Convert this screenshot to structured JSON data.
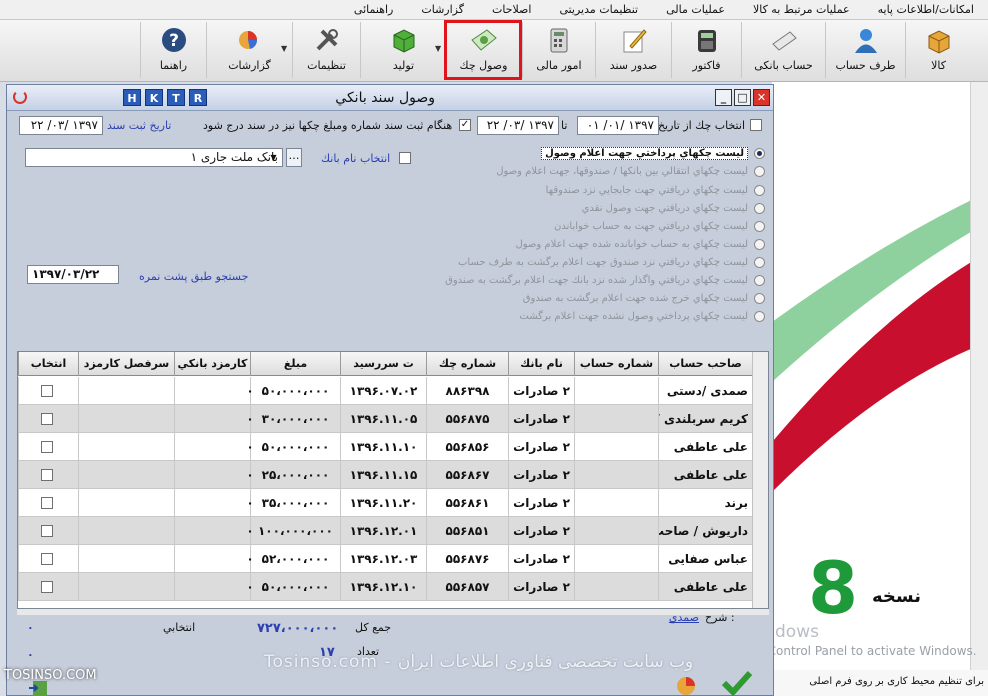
{
  "menu": [
    "امکانات/اطلاعات پایه",
    "عملیات مرتبط به کالا",
    "عملیات مالی",
    "تنظیمات مدیریتی",
    "اصلاحات",
    "گزارشات",
    "راهنمائی"
  ],
  "toolbar": {
    "kala": "کالا",
    "taraf_hesab": "طرف حساب",
    "hesab_banki": "حساب بانکی",
    "factor": "فاکتور",
    "sodoor_sanad": "صدور سند",
    "omoor_mali": "امور مالی",
    "vosool_cheque": "وصول چك",
    "tolid": "تولید",
    "tanzimat": "تنظیمات",
    "gozareshat": "گزارشات",
    "rahnama": "راهنما"
  },
  "dialog": {
    "title": "وصول سند بانكي",
    "hotkeys": [
      "H",
      "K",
      "T",
      "R"
    ],
    "filter_date_label": "انتخاب چك از تاريخ",
    "date_from": "۱۳۹۷ /۰۱/ ۰۱",
    "to_label": "تا",
    "date_to": "۱۳۹۷ /۰۳/ ۲۲",
    "insert_amount_label": "هنگام ثبت سند شماره ومبلغ چکها نیز در سند درج شود",
    "reg_date_label": "تاريخ ثبت سند",
    "reg_date": "۱۳۹۷ /۰۳/ ۲۲",
    "bank_select_label": "انتخاب نام بانك",
    "bank_name": "بانک ملت جاری ۱",
    "search_label": "جستجو طبق پشت نمره",
    "search_date": "۱۳۹۷/۰۳/۲۲",
    "radio_options": [
      "ليست چکهاي پرداختي جهت اعلام وصول",
      "ليست چکهاي انتقالي بين بانكها / صندوقها، جهت اعلام وصول",
      "ليست چکهاي دريافتي جهت جابجايي نزد صندوقها",
      "ليست چکهاي دريافتي جهت وصول نقدي",
      "ليست چکهاي دريافتي جهت به حساب خواباندن",
      "ليست چکهاي به حساب خوابانده شده جهت اعلام وصول",
      "ليست چکهاي دريافتي نزد صندوق جهت اعلام برگشت به طرف حساب",
      "ليست چکهاي دريافتي واگذار شده نزد بانك جهت اعلام برگشت به صندوق",
      "ليست چکهاي خرج شده جهت اعلام برگشت به صندوق",
      "ليست چکهاي پرداختي وصول نشده جهت اعلام برگشت"
    ],
    "columns": [
      "صاحب حساب",
      "شماره حساب",
      "نام بانك",
      "شماره چك",
      "ت سررسيد",
      "مبلغ",
      "كارمزد بانكي",
      "سرفصل كارمزد",
      "انتخاب"
    ],
    "rows": [
      {
        "owner": "صمدی /دستی",
        "bank": "۲ صادرات",
        "cheque": "۸۸۶۳۹۸",
        "due": "۱۳۹۶.۰۷.۰۲",
        "amount": "۵۰،۰۰۰،۰۰۰",
        "fee": "۰"
      },
      {
        "owner": "کریم سربلندی /دستی",
        "bank": "۲ صادرات",
        "cheque": "۵۵۶۸۷۵",
        "due": "۱۳۹۶.۱۱.۰۵",
        "amount": "۳۰،۰۰۰،۰۰۰",
        "fee": "۰"
      },
      {
        "owner": "علی عاطفی",
        "bank": "۲ صادرات",
        "cheque": "۵۵۶۸۵۶",
        "due": "۱۳۹۶.۱۱.۱۰",
        "amount": "۵۰،۰۰۰،۰۰۰",
        "fee": "۰"
      },
      {
        "owner": "علی عاطفی",
        "bank": "۲ صادرات",
        "cheque": "۵۵۶۸۶۷",
        "due": "۱۳۹۶.۱۱.۱۵",
        "amount": "۲۵،۰۰۰،۰۰۰",
        "fee": "۰"
      },
      {
        "owner": "برند",
        "bank": "۲ صادرات",
        "cheque": "۵۵۶۸۶۱",
        "due": "۱۳۹۶.۱۱.۲۰",
        "amount": "۳۵،۰۰۰،۰۰۰",
        "fee": "۰"
      },
      {
        "owner": "داریوش / صاحب ملک",
        "bank": "۲ صادرات",
        "cheque": "۵۵۶۸۵۱",
        "due": "۱۳۹۶.۱۲.۰۱",
        "amount": "۱۰۰،۰۰۰،۰۰۰",
        "fee": "۰"
      },
      {
        "owner": "عباس صفایی",
        "bank": "۲ صادرات",
        "cheque": "۵۵۶۸۷۶",
        "due": "۱۳۹۶.۱۲.۰۳",
        "amount": "۵۲،۰۰۰،۰۰۰",
        "fee": "۰"
      },
      {
        "owner": "علی عاطفی",
        "bank": "۲ صادرات",
        "cheque": "۵۵۶۸۵۷",
        "due": "۱۳۹۶.۱۲.۱۰",
        "amount": "۵۰،۰۰۰،۰۰۰",
        "fee": "۰"
      }
    ],
    "sharh_label": "شرح :",
    "sharh_value": "صمدي",
    "total_label": "جمع كل",
    "total_value": "۷۲۷،۰۰۰،۰۰۰",
    "selected_label": "انتخابي",
    "selected_value": "۰",
    "count_label": "تعداد",
    "count_value": "۱۷",
    "count_selected": "۰"
  },
  "background": {
    "version_label": "نسخه",
    "version_number": "8",
    "activate_title": "Activate Windows",
    "activate_sub": "Go to System in Control Panel to activate Windows.",
    "bottom_note": "برای تنظیم محیط کاری بر روی فرم اصلی",
    "watermark": "Tosinso.com - وب سایت تخصصی فناوری اطلاعات ایران",
    "site": "TOSINSO.COM"
  }
}
